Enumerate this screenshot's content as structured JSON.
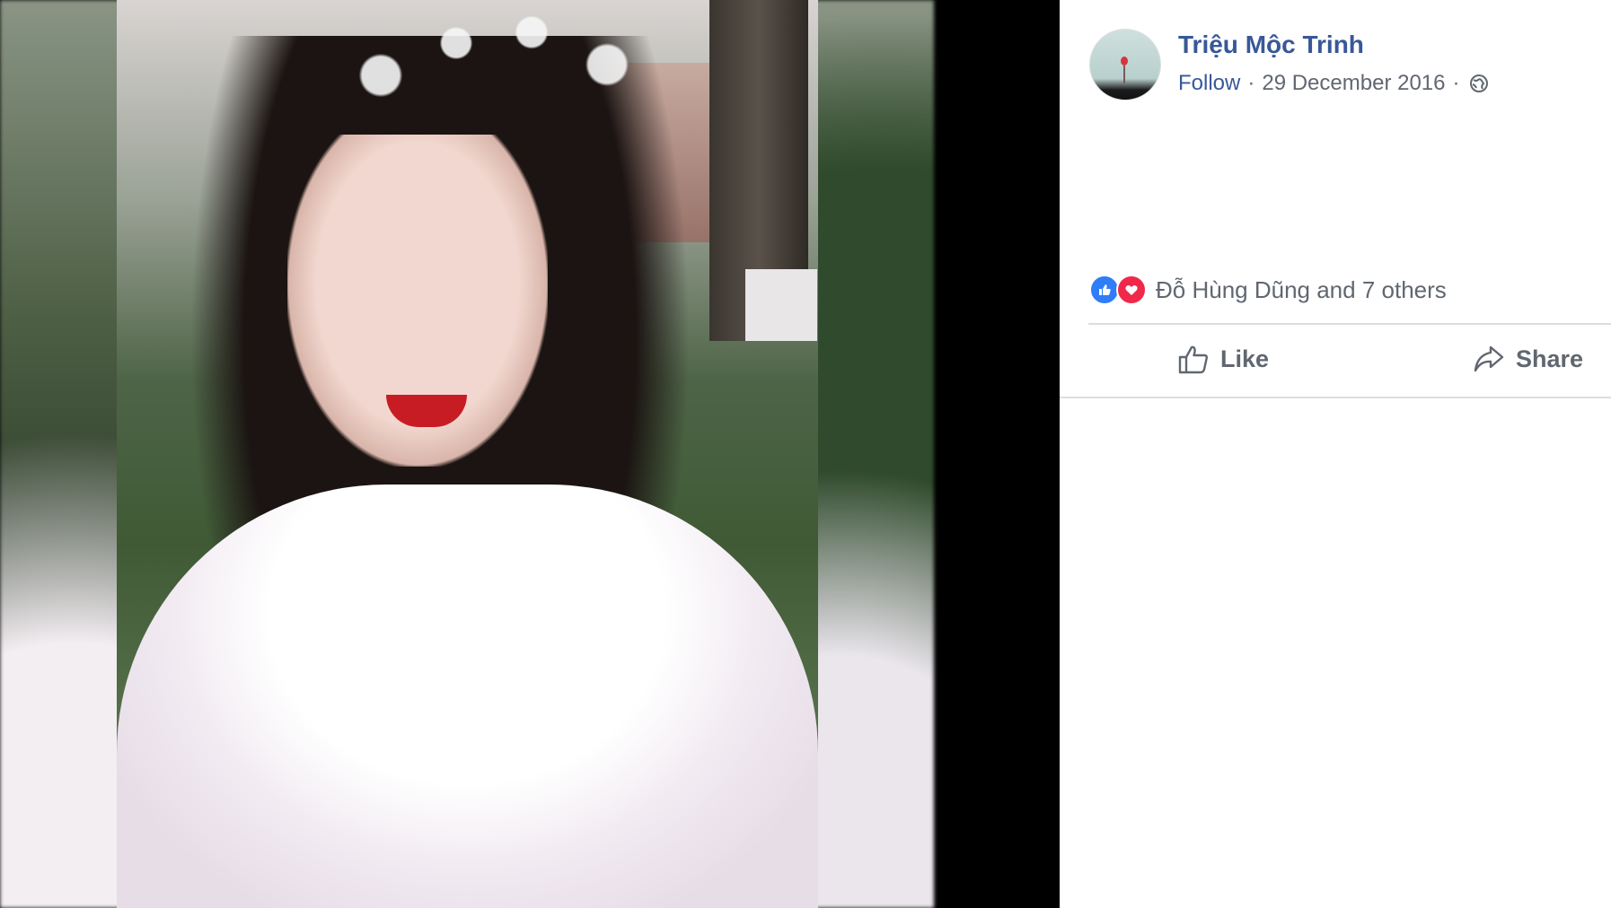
{
  "post": {
    "author": "Triệu Mộc Trinh",
    "follow_label": "Follow",
    "separator": "·",
    "date": "29 December 2016",
    "privacy_icon": "globe-icon"
  },
  "reactions": {
    "icons": [
      "like-reaction-icon",
      "love-reaction-icon"
    ],
    "summary": "Đỗ Hùng Dũng and 7 others"
  },
  "actions": {
    "like_label": "Like",
    "share_label": "Share"
  },
  "colors": {
    "link": "#385898",
    "muted": "#606770",
    "like_blue": "#2f7df7",
    "love_red": "#f0284a",
    "photo_background": "#000000"
  }
}
